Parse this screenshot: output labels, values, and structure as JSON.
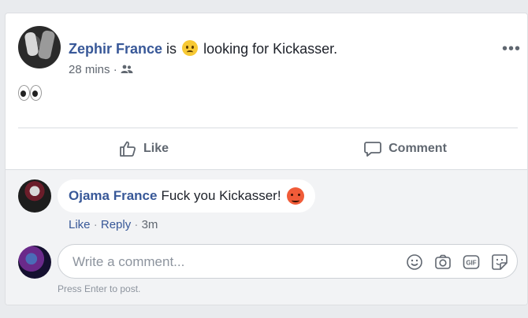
{
  "post": {
    "author": "Zephir France",
    "verb": "is",
    "feeling_icon": "confused-face-emoji",
    "activity": "looking for Kickasser.",
    "time": "28 mins",
    "time_sep": "·",
    "audience_icon": "friends-icon",
    "more_label": "•••",
    "body_icon": "eyes-emoji"
  },
  "actions": {
    "like_label": "Like",
    "comment_label": "Comment"
  },
  "comments": [
    {
      "author": "Ojama France",
      "text": "Fuck you Kickasser!",
      "emoji": "angry-face-emoji",
      "like_label": "Like",
      "sep": "·",
      "reply_label": "Reply",
      "time": "3m"
    }
  ],
  "composer": {
    "placeholder": "Write a comment...",
    "hint": "Press Enter to post.",
    "icons": [
      "emoji-icon",
      "camera-icon",
      "gif-icon",
      "sticker-icon"
    ]
  },
  "colors": {
    "link": "#385898",
    "muted": "#606770",
    "background": "#e9ebee"
  }
}
